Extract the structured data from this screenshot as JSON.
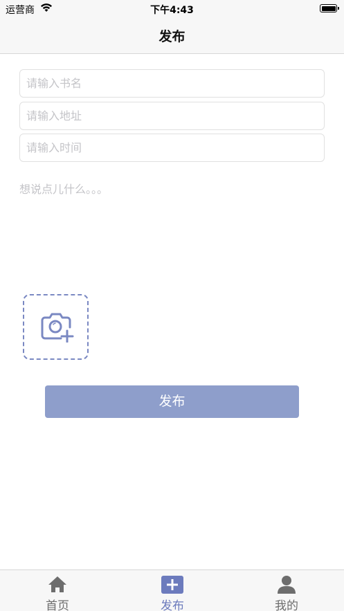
{
  "status_bar": {
    "carrier": "运营商",
    "time": "下午4:43"
  },
  "nav": {
    "title": "发布"
  },
  "form": {
    "book_placeholder": "请输入书名",
    "address_placeholder": "请输入地址",
    "time_placeholder": "请输入时间",
    "memo_placeholder": "想说点儿什么。。。"
  },
  "publish_button": {
    "label": "发布"
  },
  "tab_bar": {
    "items": [
      {
        "label": "首页",
        "icon": "home-icon"
      },
      {
        "label": "发布",
        "icon": "plus-icon",
        "active": true
      },
      {
        "label": "我的",
        "icon": "person-icon"
      }
    ]
  },
  "colors": {
    "accent": "#6c7bbd",
    "button": "#8e9ecb",
    "tab_inactive": "#6d6d6d"
  }
}
